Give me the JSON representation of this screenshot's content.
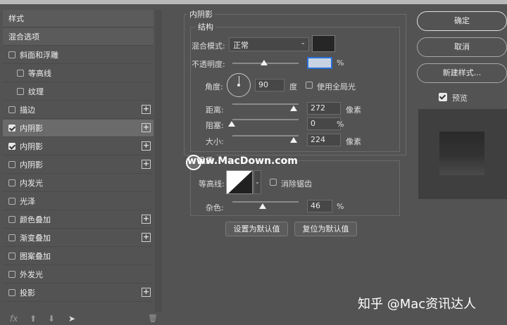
{
  "left_panel": {
    "rows": [
      {
        "label": "样式",
        "checkbox": false,
        "checked": false,
        "plus": false,
        "header": true
      },
      {
        "label": "混合选项",
        "checkbox": false,
        "checked": false,
        "plus": false,
        "header": true
      },
      {
        "label": "斜面和浮雕",
        "checkbox": true,
        "checked": false,
        "plus": false
      },
      {
        "label": "等高线",
        "checkbox": true,
        "checked": false,
        "plus": false,
        "indent": true
      },
      {
        "label": "纹理",
        "checkbox": true,
        "checked": false,
        "plus": false,
        "indent": true
      },
      {
        "label": "描边",
        "checkbox": true,
        "checked": false,
        "plus": true
      },
      {
        "label": "内阴影",
        "checkbox": true,
        "checked": true,
        "plus": true,
        "selected": true
      },
      {
        "label": "内阴影",
        "checkbox": true,
        "checked": true,
        "plus": true
      },
      {
        "label": "内阴影",
        "checkbox": true,
        "checked": false,
        "plus": true
      },
      {
        "label": "内发光",
        "checkbox": true,
        "checked": false,
        "plus": false
      },
      {
        "label": "光泽",
        "checkbox": true,
        "checked": false,
        "plus": false
      },
      {
        "label": "颜色叠加",
        "checkbox": true,
        "checked": false,
        "plus": true
      },
      {
        "label": "渐变叠加",
        "checkbox": true,
        "checked": false,
        "plus": true
      },
      {
        "label": "图案叠加",
        "checkbox": true,
        "checked": false,
        "plus": false
      },
      {
        "label": "外发光",
        "checkbox": true,
        "checked": false,
        "plus": false
      },
      {
        "label": "投影",
        "checkbox": true,
        "checked": false,
        "plus": true
      }
    ],
    "plus_symbol": "+",
    "bottom_icons": {
      "fx": "fx",
      "up": "⬆",
      "down": "⬇",
      "trash": "🗑"
    }
  },
  "inner_shadow": {
    "section_title": "内阴影",
    "structure": {
      "title": "结构",
      "blend_mode_label": "混合模式:",
      "blend_mode_value": "正常",
      "blend_color": "#262626",
      "opacity_label": "不透明度:",
      "opacity_value": "",
      "opacity_level": 48,
      "opacity_unit": "%",
      "angle_label": "角度:",
      "angle_value": "90",
      "angle_unit": "度",
      "global_light_label": "使用全局光",
      "global_light_checked": false,
      "distance_label": "距离:",
      "distance_value": "272",
      "distance_unit": "像素",
      "choke_label": "阻塞:",
      "choke_value": "0",
      "choke_unit": "%",
      "size_label": "大小:",
      "size_value": "224",
      "size_unit": "像素"
    },
    "quality": {
      "title": "品质",
      "contour_label": "等高线:",
      "antialias_label": "消除锯齿",
      "antialias_checked": false,
      "noise_label": "杂色:",
      "noise_value": "46",
      "noise_unit": "%"
    },
    "make_default_label": "设置为默认值",
    "reset_default_label": "复位为默认值"
  },
  "right_panel": {
    "ok_label": "确定",
    "cancel_label": "取消",
    "new_style_label": "新建样式...",
    "preview_label": "预览",
    "preview_checked": true
  },
  "watermark": "www.MacDown.com",
  "credit": "知乎 @Mac资讯达人"
}
